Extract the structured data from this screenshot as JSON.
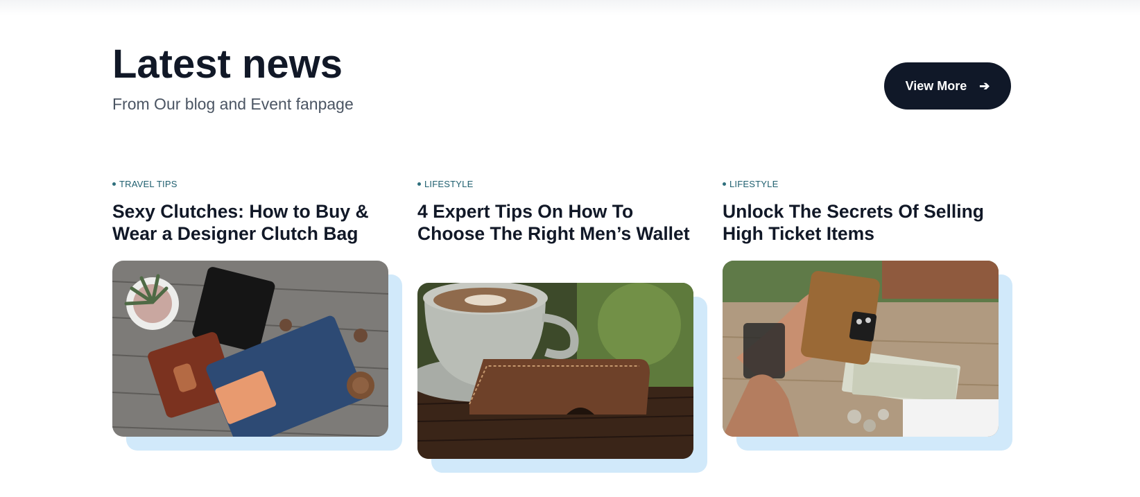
{
  "header": {
    "title": "Latest news",
    "subtitle": "From Our blog and Event fanpage",
    "view_more_label": "View More",
    "view_more_arrow": "➔"
  },
  "colors": {
    "accent_dark": "#101828",
    "category_text": "#1f5f6f",
    "image_shadow": "#d1e9fa"
  },
  "posts": [
    {
      "category": "TRAVEL TIPS",
      "title": "Sexy Clutches: How to Buy & Wear a Designer Clutch Bag",
      "image_icon": "wallets-on-wood-photo"
    },
    {
      "category": "LIFESTYLE",
      "title": "4 Expert Tips On How To Choose The Right Men’s Wallet",
      "image_icon": "coffee-and-leather-wallet-photo"
    },
    {
      "category": "LIFESTYLE",
      "title": "Unlock The Secrets Of Selling High Ticket Items",
      "image_icon": "hand-holding-wallet-photo"
    }
  ]
}
